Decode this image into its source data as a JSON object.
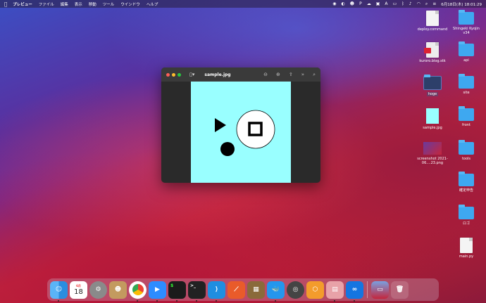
{
  "menubar": {
    "app": "プレビュー",
    "menus": [
      "ファイル",
      "編集",
      "表示",
      "移動",
      "ツール",
      "ウインドウ",
      "ヘルプ"
    ],
    "clock": "6月18日(木) 18:01:29"
  },
  "desktop": {
    "items": [
      {
        "label": "deploy.command"
      },
      {
        "label": "Shingeki Kyojin v34"
      },
      {
        "label": "kuroro.blog.stk"
      },
      {
        "label": "api"
      },
      {
        "label": "hoge"
      },
      {
        "label": "site"
      },
      {
        "label": "sample.jpg"
      },
      {
        "label": "front"
      },
      {
        "label": "screenshot 2021-06....23.png"
      },
      {
        "label": "tools"
      },
      {
        "label": "確定申告"
      },
      {
        "label": "ロゴ"
      },
      {
        "label": "main.py"
      }
    ]
  },
  "window": {
    "title": "sample.jpg"
  },
  "dock": {
    "calendar": {
      "month": "6月",
      "day": "18"
    },
    "terminal_prompt": ">_"
  },
  "colors": {
    "canvas": "#99ffff",
    "folder": "#3ea8f0"
  }
}
